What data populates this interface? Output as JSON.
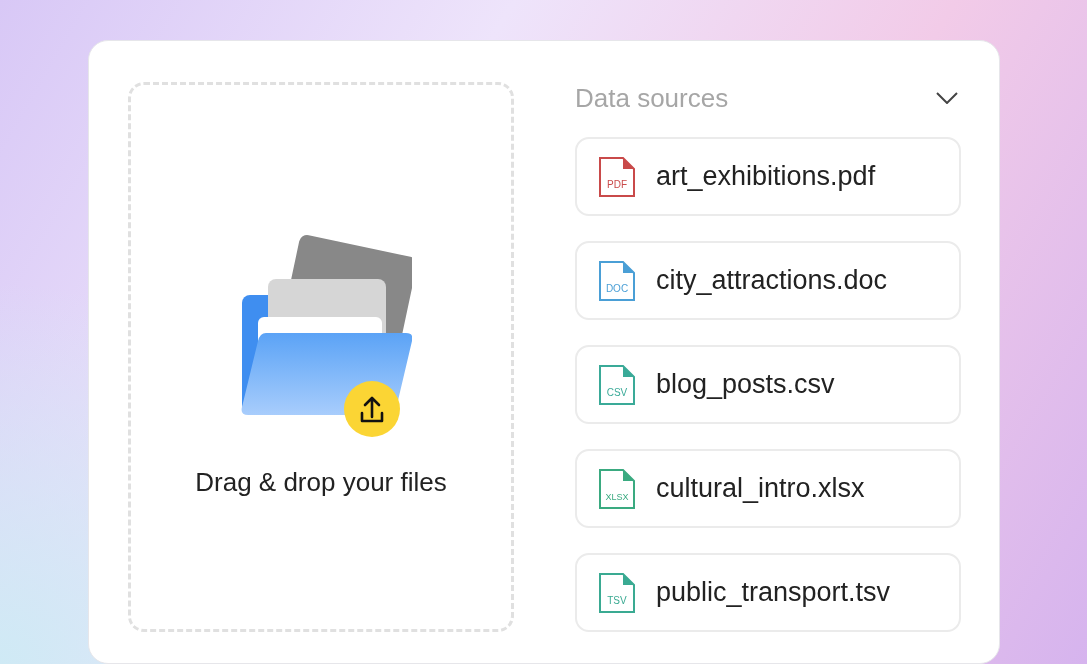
{
  "dropzone": {
    "label": "Drag & drop your files"
  },
  "sources": {
    "title": "Data sources",
    "expanded": true,
    "files": [
      {
        "name": "art_exhibitions.pdf",
        "tag": "PDF",
        "color": "#c94a4a"
      },
      {
        "name": "city_attractions.doc",
        "tag": "DOC",
        "color": "#4a9fd6"
      },
      {
        "name": "blog_posts.csv",
        "tag": "CSV",
        "color": "#3aaa98"
      },
      {
        "name": "cultural_intro.xlsx",
        "tag": "XLSX",
        "color": "#3aaa80"
      },
      {
        "name": "public_transport.tsv",
        "tag": "TSV",
        "color": "#3aaa92"
      }
    ]
  }
}
